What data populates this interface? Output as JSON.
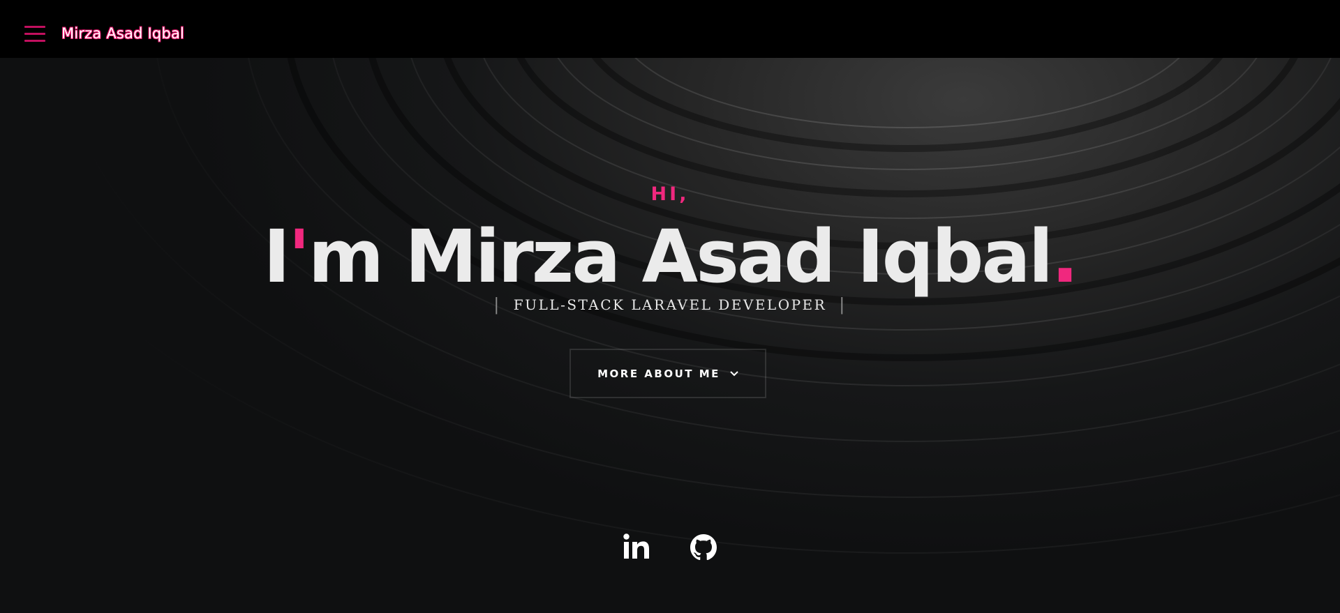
{
  "header": {
    "brand": "Mirza Asad Iqbal",
    "menu_icon": "hamburger-menu-icon"
  },
  "hero": {
    "greeting": "HI,",
    "headline_prefix": "I",
    "headline_apostrophe": "'",
    "headline_rest": "m Mirza Asad Iqbal",
    "headline_dot": ".",
    "subtitle_bar": "|",
    "subtitle": "FULL-STACK LARAVEL DEVELOPER",
    "more_button": "MORE ABOUT ME"
  },
  "social": [
    {
      "name": "LinkedIn",
      "icon": "linkedin-icon"
    },
    {
      "name": "GitHub",
      "icon": "github-icon"
    }
  ],
  "colors": {
    "accent": "#f0287e",
    "menu": "#c2105f",
    "topbar": "#000000",
    "text": "#ebebeb"
  }
}
